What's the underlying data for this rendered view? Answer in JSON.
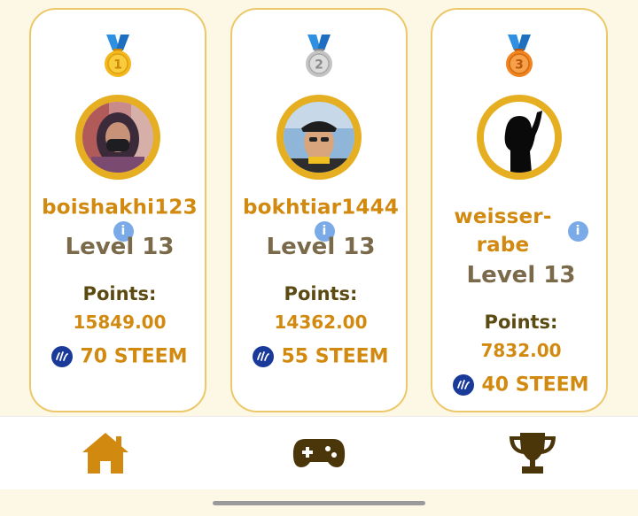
{
  "leaderboard": [
    {
      "rank": "1",
      "medal_color": "#e8a317",
      "username_lines": [
        "boishakhi123"
      ],
      "level": "Level 13",
      "points_label": "Points:",
      "points_value": "15849.00",
      "reward": "70 STEEM"
    },
    {
      "rank": "2",
      "medal_color": "#b9b9b9",
      "username_lines": [
        "bokhtiar1444"
      ],
      "level": "Level 13",
      "points_label": "Points:",
      "points_value": "14362.00",
      "reward": "55 STEEM"
    },
    {
      "rank": "3",
      "medal_color": "#ee7a1a",
      "username_lines": [
        "weisser-",
        "rabe"
      ],
      "level": "Level 13",
      "points_label": "Points:",
      "points_value": "7832.00",
      "reward": "40 STEEM"
    }
  ],
  "icons": {
    "medal": "medal-icon",
    "info": "info-icon",
    "steem": "steem-coin-icon",
    "nav_home": "home-icon",
    "nav_game": "gamepad-icon",
    "nav_trophy": "trophy-icon"
  },
  "info_glyph": "i",
  "colors": {
    "accent": "#d2890f",
    "card_border": "#ecc86a",
    "avatar_ring": "#e6ae21",
    "level_text": "#7a6a4a",
    "points_label": "#5b4a12",
    "info_badge": "#7baae8",
    "steem_blue": "#1a3a9a",
    "nav_dark": "#4a3608",
    "background": "#fdf8e6"
  }
}
